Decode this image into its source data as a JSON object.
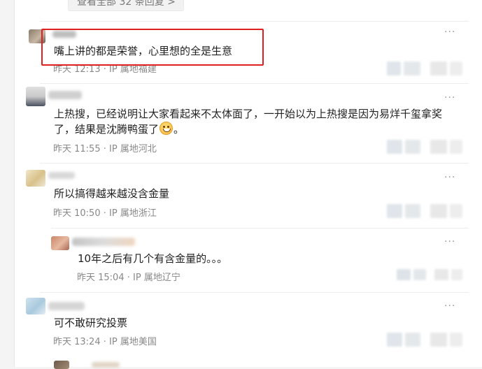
{
  "header": {
    "view_all_replies": "查看全部 32 条回复 >"
  },
  "comments": [
    {
      "nickname": "一一一",
      "text": "嘴上讲的都是荣誉，心里想的全是生意",
      "time": "昨天 12:13",
      "location": "IP 属地福建",
      "more_icon": "more-dots-icon"
    },
    {
      "text_line1": "上热搜，已经说明让大家看起来不太体面了，一开始以为上热搜是因为易烊千玺拿奖",
      "text_line2": "了，结果是沈腾鸭蛋了",
      "text_tail": "。",
      "emoji": "grinning-face-emoji",
      "time": "昨天 11:55",
      "location": "IP 属地河北"
    },
    {
      "text": "所以搞得越来越没含金量",
      "time": "昨天 10:50",
      "location": "IP 属地浙江"
    },
    {
      "text": "10年之后有几个有含金量的。。。",
      "time": "昨天 15:04",
      "location": "IP 属地辽宁",
      "is_reply": true
    },
    {
      "text": "可不敢研究投票",
      "time": "昨天 13:24",
      "location": "IP 属地美国"
    }
  ],
  "colors": {
    "highlight": "#e02020",
    "meta": "#888888",
    "text": "#222222"
  }
}
